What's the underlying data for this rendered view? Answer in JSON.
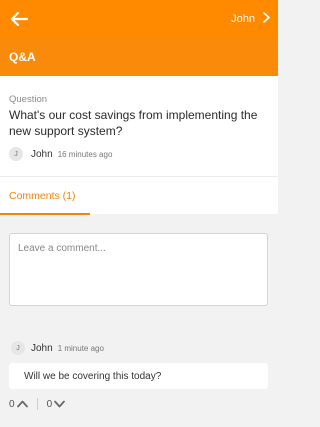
{
  "header": {
    "user_name": "John"
  },
  "section": {
    "title": "Q&A"
  },
  "question": {
    "label": "Question",
    "text": "What's our cost savings from implementing the new support system?",
    "author_initial": "J",
    "author_name": "John",
    "time_ago": "16 minutes ago"
  },
  "tabs": {
    "comments_label": "Comments (1)"
  },
  "comment_input": {
    "placeholder": "Leave a comment..."
  },
  "comments": [
    {
      "author_initial": "J",
      "author_name": "John",
      "time_ago": "1 minute ago",
      "text": "Will we be covering this today?",
      "upvotes": "0",
      "downvotes": "0"
    }
  ],
  "colors": {
    "accent": "#ff8a00",
    "tab_active": "#f2840a"
  },
  "icons": {
    "back": "back-arrow-icon",
    "user_chevron": "chevron-right-icon",
    "upvote": "chevron-up-icon",
    "downvote": "chevron-down-icon"
  }
}
